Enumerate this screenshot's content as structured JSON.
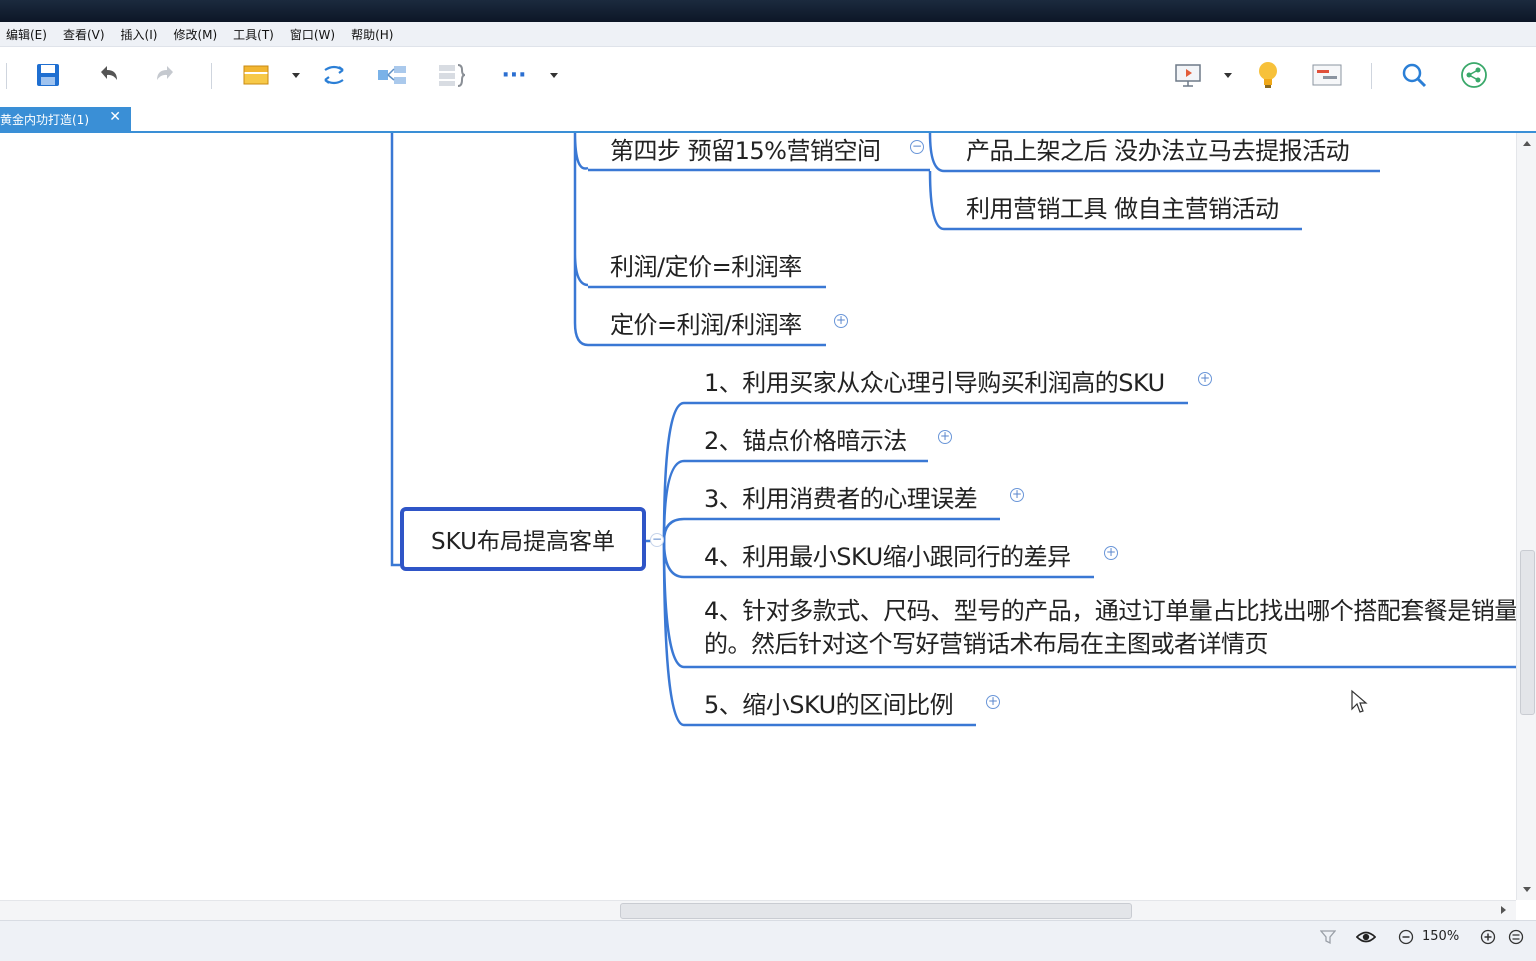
{
  "window": {
    "title": ""
  },
  "menu": [
    {
      "label": "编辑(E)"
    },
    {
      "label": "查看(V)"
    },
    {
      "label": "插入(I)"
    },
    {
      "label": "修改(M)"
    },
    {
      "label": "工具(T)"
    },
    {
      "label": "窗口(W)"
    },
    {
      "label": "帮助(H)"
    }
  ],
  "toolbar": {
    "icons": [
      "save-icon",
      "undo-icon",
      "redo-icon",
      "topic-icon",
      "relationship-icon",
      "summary-icon",
      "boundary-icon",
      "more-icon",
      "presentation-icon",
      "idea-icon",
      "gantt-icon",
      "search-icon",
      "share-icon"
    ],
    "more_label": "···"
  },
  "tab": {
    "label": "黄金内功打造(1)",
    "close": "✕"
  },
  "colors": {
    "accent": "#3a8fd6",
    "line": "#3a78d4",
    "root_border": "#2f55c7"
  },
  "mindmap": {
    "root": "SKU布局提高客单",
    "upper_nodes": [
      {
        "text": "第四步 预留15%营销空间"
      },
      {
        "text": "利润/定价=利润率"
      },
      {
        "text": "定价=利润/利润率"
      }
    ],
    "sub_nodes": [
      {
        "text": "产品上架之后 没办法立马去提报活动"
      },
      {
        "text": "利用营销工具 做自主营销活动"
      }
    ],
    "children": [
      {
        "text": "1、利用买家从众心理引导购买利润高的SKU"
      },
      {
        "text": "2、锚点价格暗示法"
      },
      {
        "text": "3、利用消费者的心理误差"
      },
      {
        "text": "4、利用最小SKU缩小跟同行的差异"
      },
      {
        "text": "4、针对多款式、尺码、型号的产品，通过订单量占比找出哪个搭配套餐是销量的。然后针对这个写好营销话术布局在主图或者详情页"
      },
      {
        "text": "5、缩小SKU的区间比例"
      }
    ],
    "expand_plus": "+",
    "collapse_minus": "−"
  },
  "status": {
    "zoom": "150%"
  }
}
